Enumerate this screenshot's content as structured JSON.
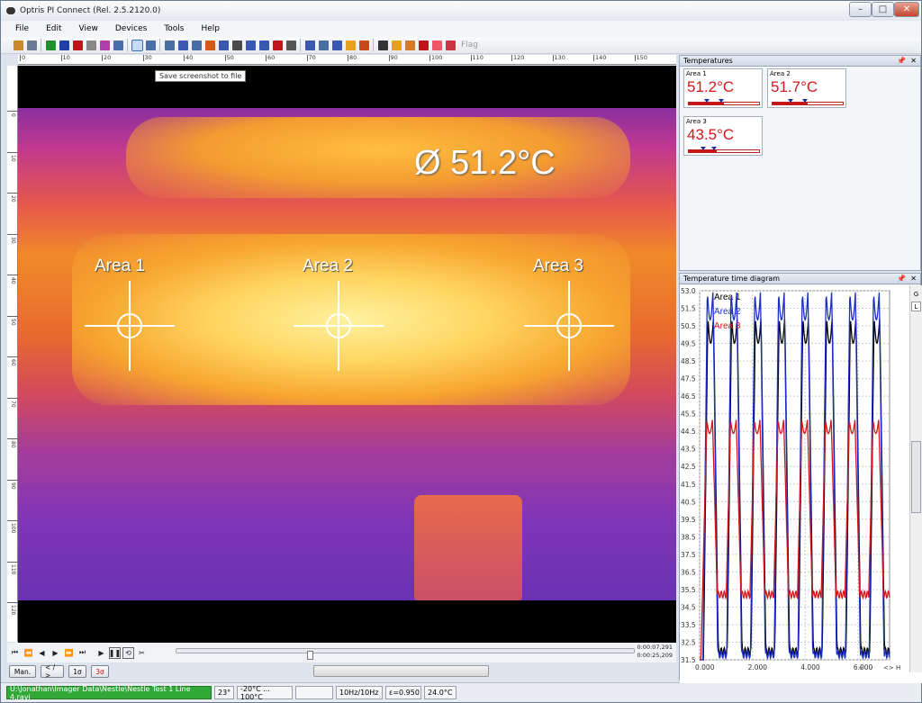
{
  "window": {
    "title": "Optris PI Connect (Rel. 2.5.2120.0)"
  },
  "menu": [
    "File",
    "Edit",
    "View",
    "Devices",
    "Tools",
    "Help"
  ],
  "toolbar": {
    "icons": [
      "folder-open-icon",
      "save-icon",
      "play-icon",
      "pause-icon",
      "stop-icon",
      "record-icon",
      "camera-icon",
      "copy-icon",
      "screenshot-icon",
      "screenshot-list-icon",
      "document-icon",
      "histogram-icon",
      "graph-icon",
      "layers-icon",
      "profile-icon",
      "line-icon",
      "multi-line-icon",
      "grid-icon",
      "bar-icon",
      "ruler-icon",
      "fit-icon",
      "layout1-icon",
      "layout2-icon",
      "palette-icon",
      "tools-icon",
      "chip-icon",
      "gradient-icon",
      "mosaic-icon",
      "area-icon",
      "flag-icon",
      "image-icon"
    ],
    "colors": [
      "#c88a2a",
      "#6a7a92",
      "#1f8e2d",
      "#1f3fa8",
      "#c0141b",
      "#888888",
      "#b03dac",
      "#4b6ea8",
      "#3d62b0",
      "#4b6ea8",
      "#4a6ea0",
      "#3a58b0",
      "#4a6ea0",
      "#d05b14",
      "#3a58b0",
      "#4a4a4a",
      "#3a58b0",
      "#3a58b0",
      "#c0141b",
      "#555555",
      "#3a58b0",
      "#4a6ea0",
      "#3a58b0",
      "#e8a020",
      "#c84a1a",
      "#333333",
      "#e8a020",
      "#d47a2a",
      "#c0141b",
      "#ee5566",
      "#cc3344"
    ],
    "flag": "Flag",
    "tooltip": "Save screenshot to file"
  },
  "ruler_h": [
    "0",
    "10",
    "20",
    "30",
    "40",
    "50",
    "60",
    "70",
    "80",
    "90",
    "100",
    "110",
    "120",
    "130",
    "140",
    "150"
  ],
  "ruler_v": [
    "0",
    "10",
    "20",
    "30",
    "40",
    "50",
    "60",
    "70",
    "80",
    "90",
    "100",
    "110",
    "120"
  ],
  "viewer": {
    "avg_label": "Ø   51.2°C",
    "areas": [
      "Area 1",
      "Area 2",
      "Area 3"
    ]
  },
  "playback": {
    "time1": "0:00:07,291",
    "time2": "0:00:25,209",
    "position": 0.29,
    "buttons": [
      "Man.",
      "< / >",
      "1σ",
      "3σ"
    ]
  },
  "status": {
    "path": "U:\\Jonathan\\Imager Data\\Nestle\\Nestle Test 1 Line 4.ravi",
    "ambient": "23°",
    "range": "-20°C ... 100°C",
    "rate": "10Hz/10Hz",
    "emissivity": "ε=0.950",
    "temp": "24.0°C"
  },
  "temperatures_panel": {
    "title": "Temperatures",
    "cards": [
      {
        "name": "Area 1",
        "value": "51.2°C",
        "fill": 0.5
      },
      {
        "name": "Area 2",
        "value": "51.7°C",
        "fill": 0.5
      },
      {
        "name": "Area 3",
        "value": "43.5°C",
        "fill": 0.4
      }
    ]
  },
  "diagram_panel": {
    "title": "Temperature time diagram",
    "side_buttons": [
      "G",
      "L"
    ],
    "bottom_controls": [
      "+",
      "-",
      "<>",
      "H"
    ]
  },
  "chart_data": {
    "type": "line",
    "title": "Temperature time diagram",
    "xlabel": "",
    "ylabel": "",
    "xlim": [
      0,
      7.2
    ],
    "ylim": [
      31.5,
      53.0
    ],
    "x_ticks": [
      "0.000",
      "2.000",
      "4.000",
      "6.000"
    ],
    "y_ticks": [
      "53.0",
      "51.5",
      "50.5",
      "49.5",
      "48.5",
      "47.5",
      "46.5",
      "45.5",
      "44.5",
      "43.5",
      "42.5",
      "41.5",
      "40.5",
      "39.5",
      "38.5",
      "37.5",
      "36.5",
      "35.5",
      "34.5",
      "33.5",
      "32.5",
      "31.5"
    ],
    "grid": true,
    "legend_position": "top-left",
    "series": [
      {
        "name": "Area 1",
        "color": "#000000",
        "peak": 51.5,
        "trough": 32.0
      },
      {
        "name": "Area 2",
        "color": "#1c2fc8",
        "peak": 53.0,
        "trough": 31.8
      },
      {
        "name": "Area 3",
        "color": "#d4171c",
        "peak": 45.5,
        "trough": 35.3
      }
    ],
    "cycles": 8
  }
}
